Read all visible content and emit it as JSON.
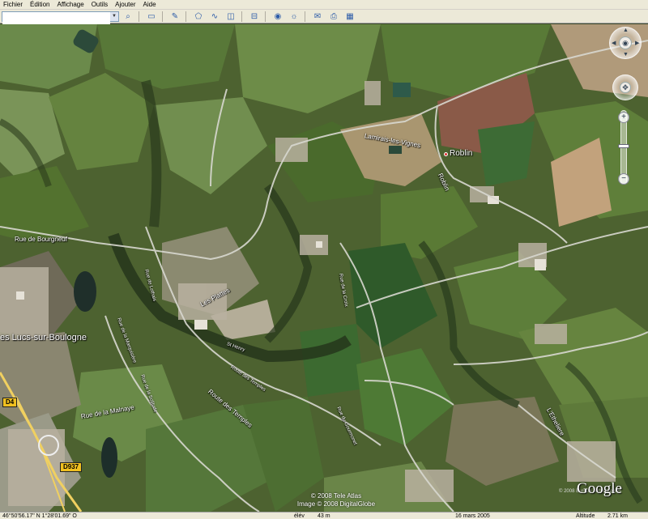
{
  "menu": [
    "Fichier",
    "Édition",
    "Affichage",
    "Outils",
    "Ajouter",
    "Aide"
  ],
  "toolbar": {
    "search_value": "",
    "search_icon": "magnifier-icon",
    "buttons": [
      "sidebar-toggle-icon",
      "placemark-icon",
      "polygon-icon",
      "path-icon",
      "overlay-icon",
      "ruler-icon",
      "planet-icon",
      "sun-icon",
      "email-icon",
      "print-icon",
      "google-maps-icon"
    ]
  },
  "map": {
    "labels": {
      "lamirais": "Lamirais-les-Vignes",
      "roblin": "Roblin",
      "roblin_road": "Roblin",
      "bourgneuf": "Rue de Bourgneuf",
      "lucs": "es Lucs-sur-Boulogne",
      "plattes": "Les Plattes",
      "malnaye": "Rue de la Malnaye",
      "route_temples": "Route des Temples",
      "etheliere": "L'Etheliere",
      "rue_gourmonet": "Rue du Gourmonet",
      "rue_long_road": "Rue de la Croix",
      "route_paris_left": "Rue de la Marquisière",
      "route_n": "Rue de Lothais",
      "route_diagonal": "Rue de la Solitude",
      "route_short": "Route des Temples",
      "st_henry": "St Henry"
    },
    "shields": {
      "d4": "D4",
      "d937": "D937"
    }
  },
  "credits": {
    "line1": "© 2008 Tele Atlas",
    "line2": "Image © 2008 DigitalGlobe",
    "small": "© 2008 Europa Technologies",
    "logo": "Google"
  },
  "status": {
    "coords": "46°50'56.17\" N    1°28'01.69\" O",
    "elev_label": "élév",
    "elev_value": "43 m",
    "date": "16 mars 2005",
    "alt_label": "Altitude",
    "alt_value": "2.71 km"
  },
  "colors": {
    "accent": "#2a5aa8",
    "road": "#d8d8d8",
    "shield": "#f0c020"
  }
}
